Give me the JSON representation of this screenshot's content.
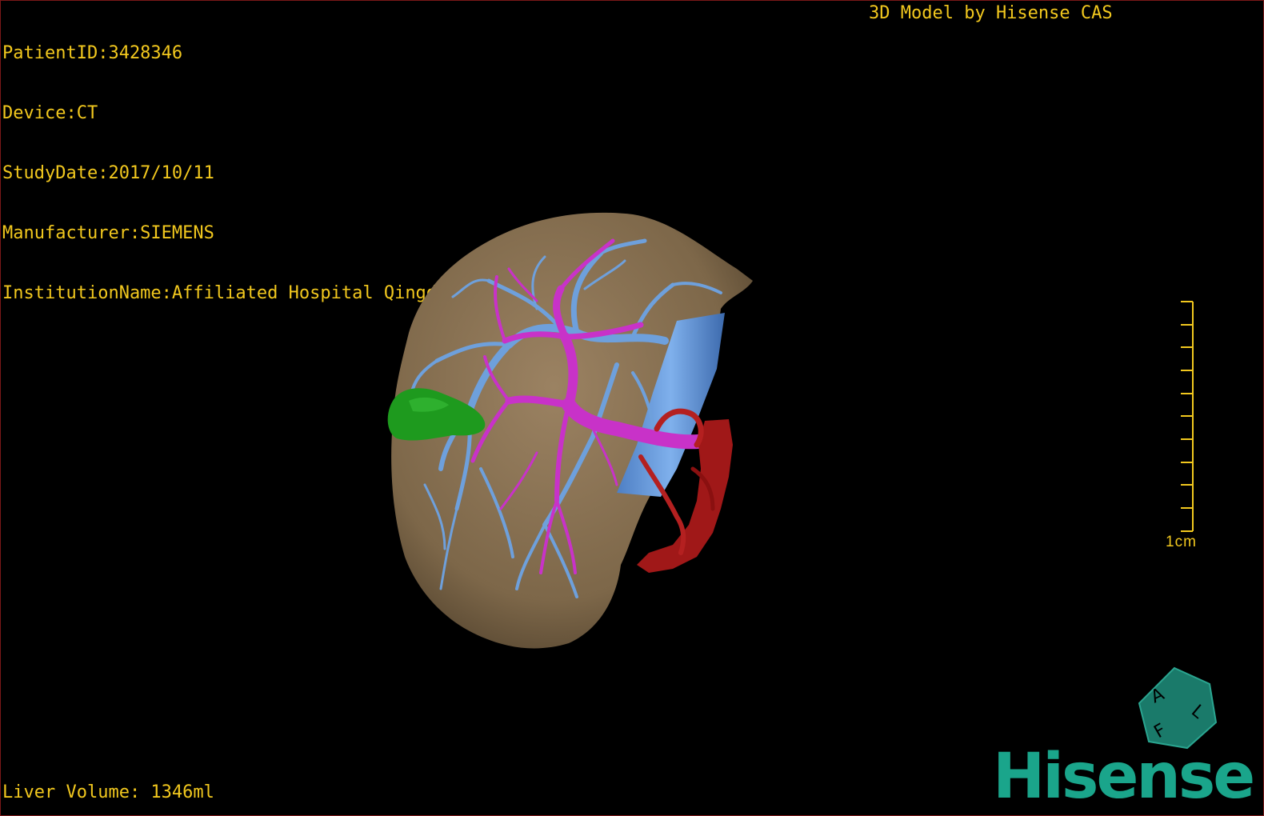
{
  "overlay": {
    "patient_id": "PatientID:3428346",
    "device": "Device:CT",
    "study_date": "StudyDate:2017/10/11",
    "manufacturer": "Manufacturer:SIEMENS",
    "institution": "InstitutionName:Affiliated Hospital Qingdao University-C",
    "model_credit": "3D Model by Hisense CAS",
    "liver_volume": "Liver Volume: 1346ml"
  },
  "scale": {
    "label": "1cm"
  },
  "orientation_cube": {
    "faces": [
      "A",
      "F",
      "L"
    ]
  },
  "brand": {
    "name": "Hisense"
  },
  "colors": {
    "overlay_text": "#f2c81e",
    "liver": "#8a7355",
    "portal_vein": "#c832c8",
    "hepatic_vein": "#6ea0dc",
    "artery": "#a01818",
    "gallbladder": "#1e9a1e",
    "brand": "#1aa58b"
  }
}
